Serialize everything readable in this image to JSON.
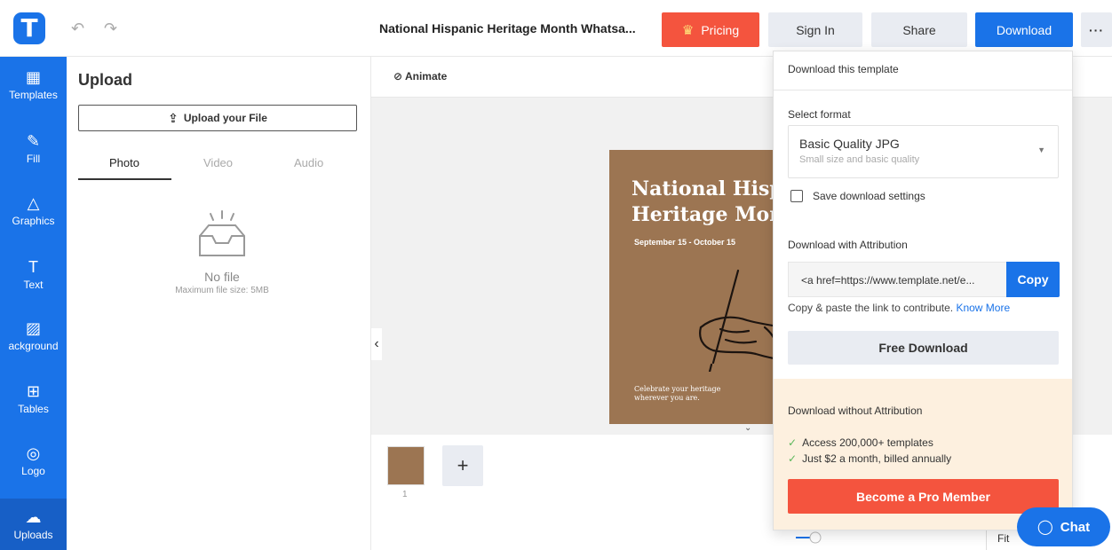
{
  "header": {
    "logo_letter": "T",
    "undo": "↶",
    "redo": "↷",
    "doc_title": "National Hispanic Heritage Month Whatsa...",
    "pricing_label": "Pricing",
    "signin_label": "Sign In",
    "share_label": "Share",
    "download_label": "Download",
    "more_label": "···"
  },
  "sidebar": {
    "items": [
      {
        "label": "Templates",
        "icon": "▦"
      },
      {
        "label": "Fill",
        "icon": "✎"
      },
      {
        "label": "Graphics",
        "icon": "△"
      },
      {
        "label": "Text",
        "icon": "T"
      },
      {
        "label": "ackground",
        "icon": "▨"
      },
      {
        "label": "Tables",
        "icon": "⊞"
      },
      {
        "label": "Logo",
        "icon": "◎"
      },
      {
        "label": "Uploads",
        "icon": "☁"
      }
    ]
  },
  "panel": {
    "title": "Upload",
    "upload_button": "Upload your File",
    "tabs": [
      "Photo",
      "Video",
      "Audio"
    ],
    "empty_title": "No file",
    "empty_sub": "Maximum file size: 5MB"
  },
  "canvas": {
    "animate_label": "Animate",
    "poster_title_1": "National Hispa",
    "poster_title_2": "Heritage Mont",
    "poster_dates": "September 15 - October 15",
    "poster_tagline": "Celebrate your heritage wherever you are.",
    "page_number": "1",
    "add_page": "+",
    "zoom_fit": "Fit"
  },
  "download_panel": {
    "heading": "Download this template",
    "select_format_label": "Select format",
    "format_title": "Basic Quality JPG",
    "format_sub": "Small size and basic quality",
    "save_settings_label": "Save download settings",
    "attribution_label": "Download with Attribution",
    "attribution_value": "<a href=https://www.template.net/e...",
    "copy_label": "Copy",
    "copy_note": "Copy & paste the link to contribute.",
    "know_more": "Know More",
    "free_download": "Free Download",
    "without_attr_label": "Download without Attribution",
    "benefit_1": "Access 200,000+ templates",
    "benefit_2": "Just $2 a month, billed annually",
    "pro_button": "Become a Pro Member"
  },
  "chat": {
    "label": "Chat"
  },
  "colors": {
    "primary": "#1a73e8",
    "accent": "#f4543e",
    "poster": "#9c7552",
    "pro_bg": "#fdf0df"
  }
}
